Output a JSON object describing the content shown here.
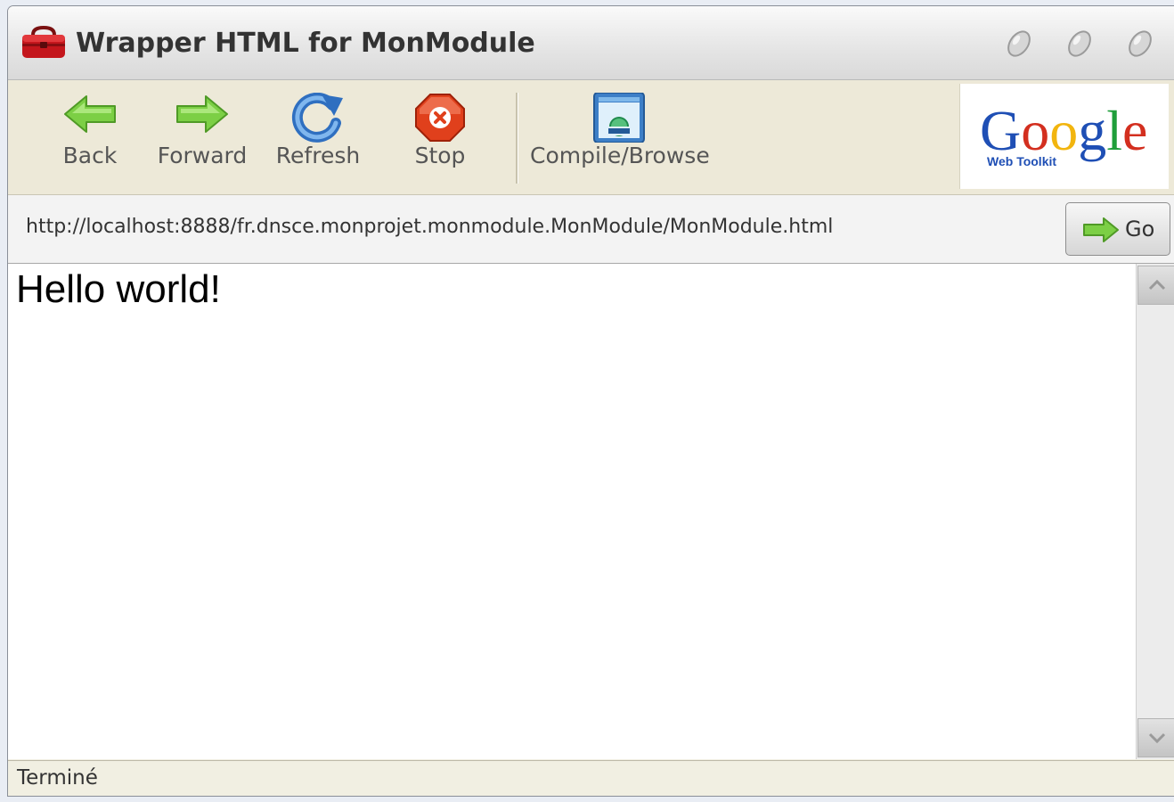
{
  "window": {
    "title": "Wrapper HTML for MonModule"
  },
  "toolbar": {
    "buttons": [
      {
        "label": "Back",
        "icon": "back-arrow-icon"
      },
      {
        "label": "Forward",
        "icon": "forward-arrow-icon"
      },
      {
        "label": "Refresh",
        "icon": "refresh-icon"
      },
      {
        "label": "Stop",
        "icon": "stop-icon"
      },
      {
        "label": "Compile/Browse",
        "icon": "compile-browse-icon"
      }
    ],
    "logo": {
      "word": "Google",
      "subtitle": "Web Toolkit"
    }
  },
  "address": {
    "url": "http://localhost:8888/fr.dnsce.monprojet.monmodule.MonModule/MonModule.html",
    "go_label": "Go"
  },
  "content": {
    "text": "Hello world!"
  },
  "status": {
    "text": "Terminé"
  },
  "colors": {
    "toolbar_bg": "#ede9d8",
    "arrow_green": "#6fc13a",
    "stop_red": "#e0401c",
    "refresh_blue": "#3a7fd0"
  }
}
